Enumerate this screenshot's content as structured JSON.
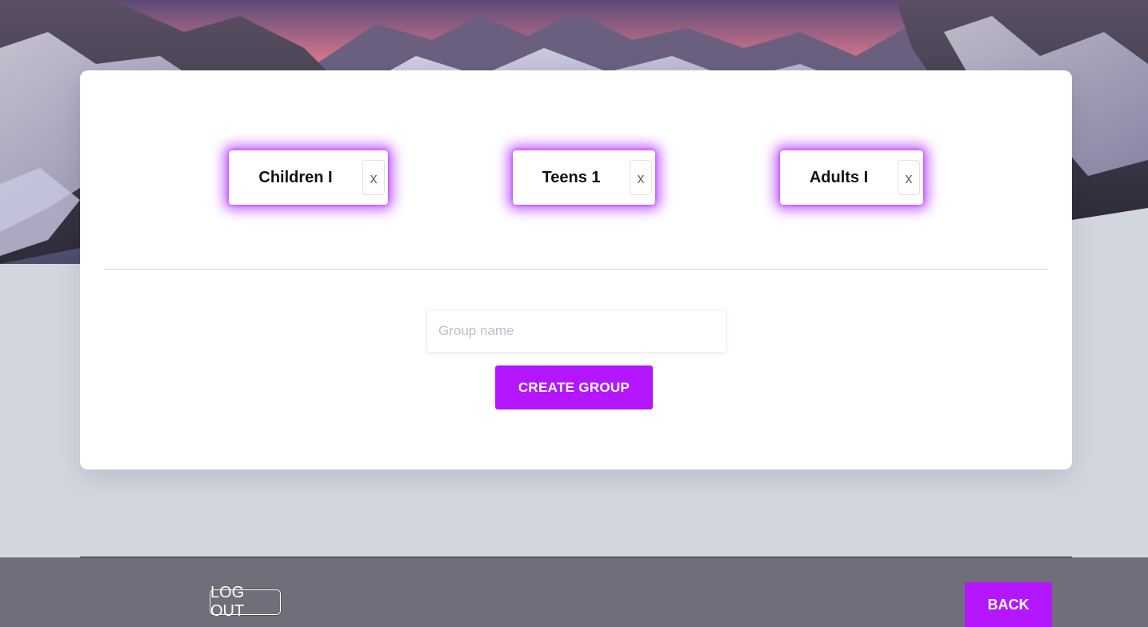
{
  "groups": [
    {
      "label": "Children I",
      "remove": "x"
    },
    {
      "label": "Teens 1",
      "remove": "x"
    },
    {
      "label": "Adults I",
      "remove": "x"
    }
  ],
  "form": {
    "placeholder": "Group name",
    "value": "",
    "create_label": "CREATE GROUP"
  },
  "footer": {
    "logout_label": "LOG OUT",
    "back_label": "BACK"
  },
  "colors": {
    "accent": "#b416ff",
    "page_bg": "#d2d6de",
    "footer_bg": "#716e7b"
  }
}
